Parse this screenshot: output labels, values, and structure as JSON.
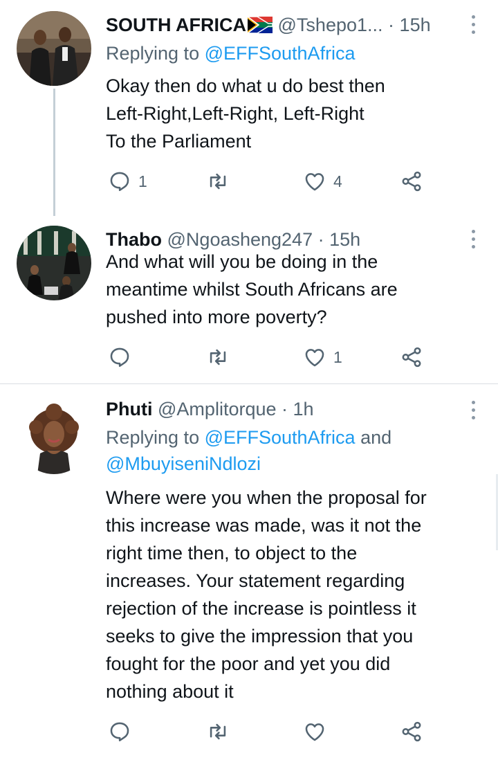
{
  "colors": {
    "text": "#0f1419",
    "muted": "#536471",
    "link": "#1d9bf0",
    "icon": "#536471"
  },
  "tweets": [
    {
      "name": "SOUTH AFRICA",
      "flag": "south-africa-flag-emoji",
      "handle": "@Tshepo1...",
      "dot": "·",
      "time": "15h",
      "replying_prefix": "Replying to ",
      "replying_to": "@EFFSouthAfrica",
      "lines": [
        "Okay then do what u do best then",
        "Left-Right,Left-Right, Left-Right",
        "To the Parliament"
      ],
      "replies": "1",
      "retweets": "",
      "likes": "4"
    },
    {
      "name": "Thabo",
      "handle": "@Ngoasheng247",
      "dot": "·",
      "time": "15h",
      "lines": [
        "And what will you be doing in the",
        "meantime whilst South Africans are",
        "pushed into more poverty?"
      ],
      "replies": "",
      "retweets": "",
      "likes": "1"
    },
    {
      "name": "Phuti",
      "handle": "@Amplitorque",
      "dot": "·",
      "time": "1h",
      "replying_prefix": "Replying to ",
      "replying_to_1": "@EFFSouthAfrica",
      "replying_and": " and",
      "replying_to_2": "@MbuyiseniNdlozi",
      "lines": [
        "Where were you when the proposal for",
        "this increase was made, was it not the",
        "right time then, to object to the",
        "increases. Your statement regarding",
        "rejection of the increase is pointless it",
        "seeks to give the impression that you",
        "fought for the poor and yet you did",
        "nothing about it"
      ],
      "replies": "",
      "retweets": "",
      "likes": ""
    }
  ]
}
